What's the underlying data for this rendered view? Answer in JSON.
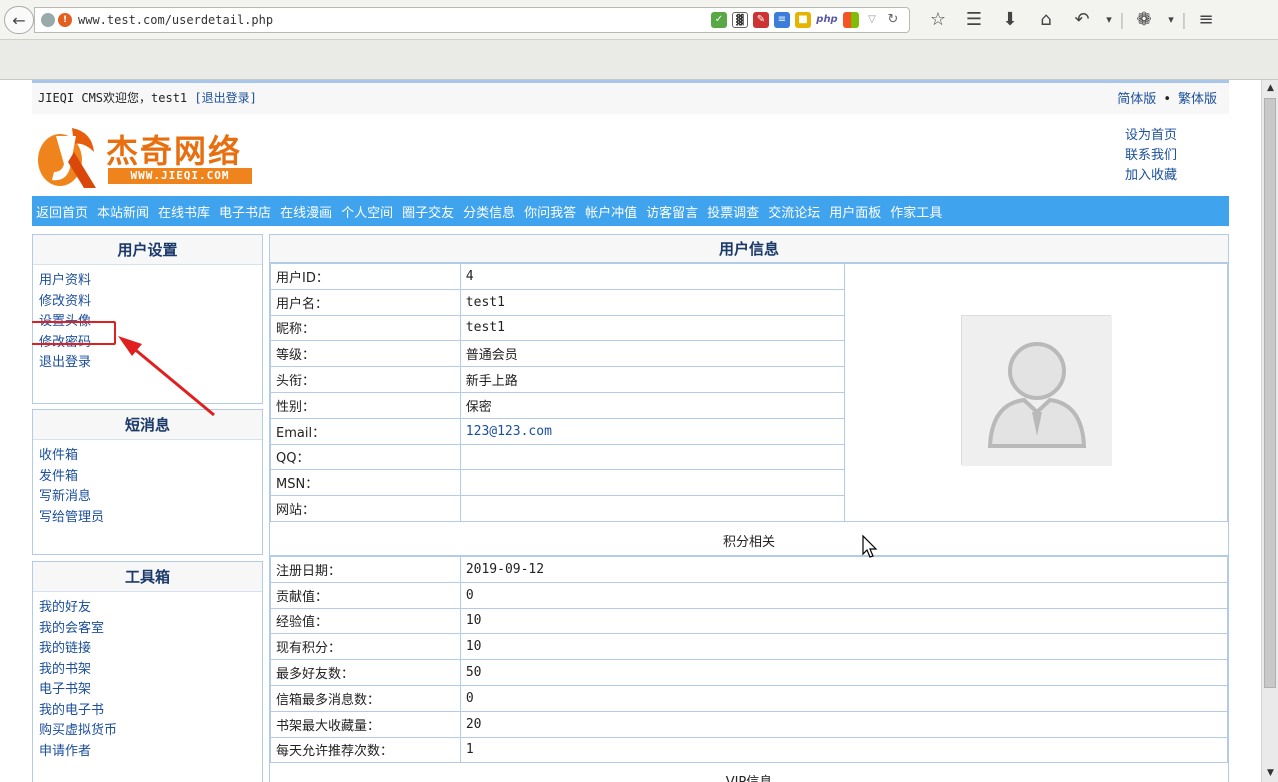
{
  "browser": {
    "url": "www.test.com/userdetail.php",
    "ext_php": "php"
  },
  "topbar": {
    "welcome": "JIEQI CMS欢迎您，test1 ",
    "logout_link": "[退出登录]",
    "simplified": "简体版",
    "dot": "•",
    "traditional": "繁体版"
  },
  "header": {
    "logo_cn": "杰奇网络",
    "logo_en": "WWW.JIEQI.COM",
    "links": [
      "设为首页",
      "联系我们",
      "加入收藏"
    ]
  },
  "nav": [
    "返回首页",
    "本站新闻",
    "在线书库",
    "电子书店",
    "在线漫画",
    "个人空间",
    "圈子交友",
    "分类信息",
    "你问我答",
    "帐户冲值",
    "访客留言",
    "投票调查",
    "交流论坛",
    "用户面板",
    "作家工具"
  ],
  "sidebar": {
    "user_settings": {
      "title": "用户设置",
      "items": [
        "用户资料",
        "修改资料",
        "设置头像",
        "修改密码",
        "退出登录"
      ]
    },
    "messages": {
      "title": "短消息",
      "items": [
        "收件箱",
        "发件箱",
        "写新消息",
        "写给管理员"
      ]
    },
    "toolbox": {
      "title": "工具箱",
      "items": [
        "我的好友",
        "我的会客室",
        "我的链接",
        "我的书架",
        "电子书架",
        "我的电子书",
        "购买虚拟货币",
        "申请作者"
      ]
    }
  },
  "main": {
    "title": "用户信息",
    "basic": [
      {
        "label": "用户ID：",
        "value": "4"
      },
      {
        "label": "用户名：",
        "value": "test1"
      },
      {
        "label": "昵称：",
        "value": "test1"
      },
      {
        "label": "等级：",
        "value": "普通会员"
      },
      {
        "label": "头衔：",
        "value": "新手上路"
      },
      {
        "label": "性别：",
        "value": "保密"
      },
      {
        "label": "Email：",
        "value": "123@123.com"
      },
      {
        "label": "QQ：",
        "value": ""
      },
      {
        "label": "MSN：",
        "value": ""
      },
      {
        "label": "网站：",
        "value": ""
      }
    ],
    "points_section": "积分相关",
    "points": [
      {
        "label": "注册日期：",
        "value": "2019-09-12"
      },
      {
        "label": "贡献值：",
        "value": "0"
      },
      {
        "label": "经验值：",
        "value": "10"
      },
      {
        "label": "现有积分：",
        "value": "10"
      },
      {
        "label": "最多好友数：",
        "value": "50"
      },
      {
        "label": "信箱最多消息数：",
        "value": "0"
      },
      {
        "label": "书架最大收藏量：",
        "value": "20"
      },
      {
        "label": "每天允许推荐次数：",
        "value": "1"
      }
    ],
    "vip_section": "VIP信息"
  },
  "colors": {
    "nav_bg": "#3fa3ee",
    "link": "#1b4f9c",
    "highlight": "#e0201e",
    "logo_orange": "#e86f10"
  }
}
